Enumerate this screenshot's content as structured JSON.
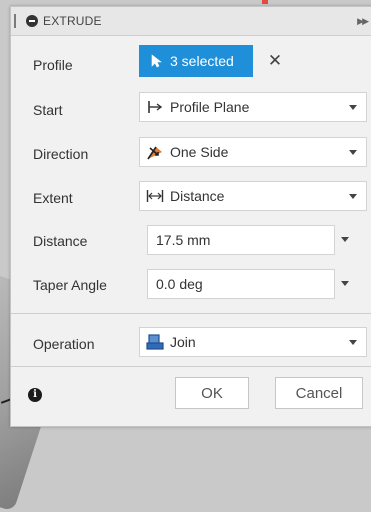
{
  "dialog": {
    "title": "EXTRUDE"
  },
  "fields": {
    "profile": {
      "label": "Profile",
      "value": "3 selected",
      "icon": "cursor-select-icon"
    },
    "start": {
      "label": "Start",
      "value": "Profile Plane",
      "icon": "profile-plane-icon"
    },
    "direction": {
      "label": "Direction",
      "value": "One Side",
      "icon": "one-side-icon"
    },
    "extent": {
      "label": "Extent",
      "value": "Distance",
      "icon": "distance-icon"
    },
    "distance": {
      "label": "Distance",
      "value": "17.5 mm"
    },
    "taper_angle": {
      "label": "Taper Angle",
      "value": "0.0 deg"
    },
    "operation": {
      "label": "Operation",
      "value": "Join",
      "icon": "join-icon"
    }
  },
  "buttons": {
    "ok": "OK",
    "cancel": "Cancel"
  },
  "colors": {
    "accent": "#1e8fd8",
    "panel_bg": "#f1f1f1",
    "direction_icon": "#e07a2e",
    "join_icon": "#2f6bb7"
  }
}
